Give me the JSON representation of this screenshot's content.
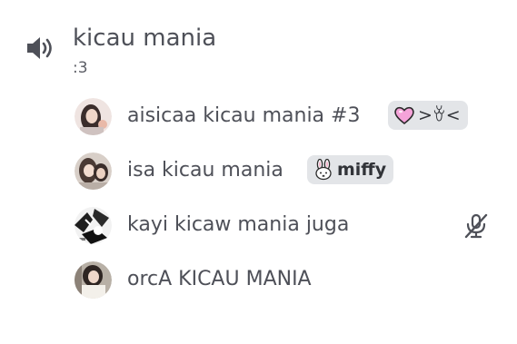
{
  "channel": {
    "name": "kicau mania",
    "status": ":3",
    "icon": "speaker-icon"
  },
  "members": [
    {
      "name": "aisicaa kicau mania #3",
      "avatar": "avatar-photo",
      "tag": {
        "text": ">ꈊ<",
        "icon": "heart-icon",
        "color": "#f5a3d9"
      }
    },
    {
      "name": "isa kicau mania",
      "avatar": "avatar-photo",
      "tag": {
        "text": "miffy",
        "icon": "bunny-icon"
      }
    },
    {
      "name": "kayi kicaw mania juga",
      "avatar": "avatar-photo-bw",
      "muted": true,
      "status_icon": "microphone-muted-icon"
    },
    {
      "name": "orcA KICAU MANIA",
      "avatar": "avatar-photo"
    }
  ],
  "colors": {
    "text": "#4e5058",
    "tag_bg": "#e3e5e8",
    "heart": "#f5a3d9"
  }
}
